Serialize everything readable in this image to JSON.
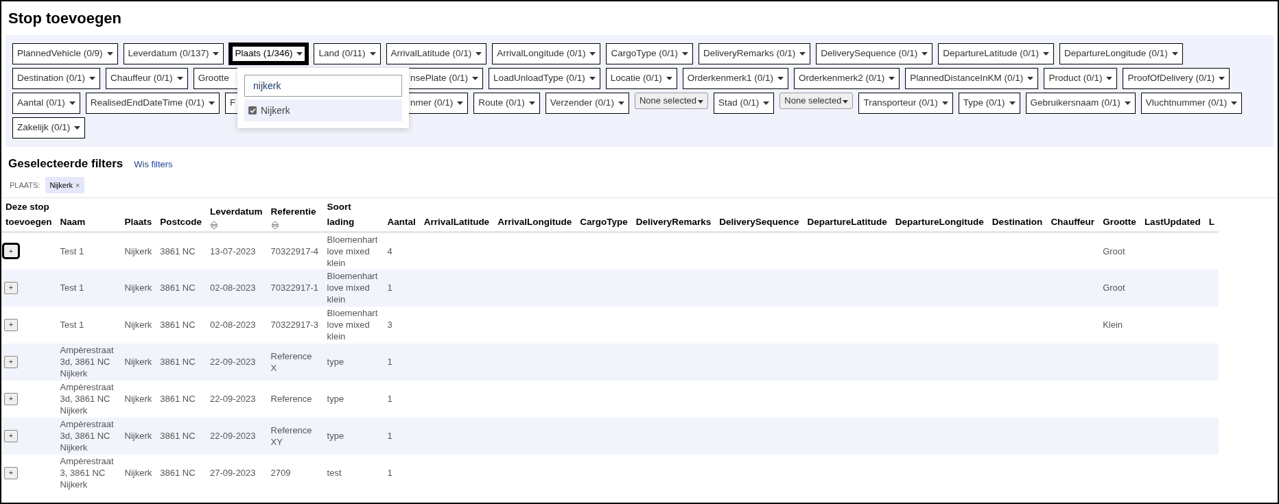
{
  "page": {
    "title": "Stop toevoegen"
  },
  "filter_rows": [
    [
      {
        "label": "PlannedVehicle (0/9)",
        "kind": "dropdown",
        "selected": false
      },
      {
        "label": "Leverdatum (0/137)",
        "kind": "dropdown",
        "selected": false
      },
      {
        "label": "Plaats (1/346)",
        "kind": "dropdown",
        "selected": true
      },
      {
        "label": "Land (0/11)",
        "kind": "dropdown",
        "selected": false
      },
      {
        "label": "ArrivalLatitude (0/1)",
        "kind": "dropdown",
        "selected": false
      },
      {
        "label": "ArrivalLongitude (0/1)",
        "kind": "dropdown",
        "selected": false
      },
      {
        "label": "CargoType (0/1)",
        "kind": "dropdown",
        "selected": false
      },
      {
        "label": "DeliveryRemarks (0/1)",
        "kind": "dropdown",
        "selected": false
      },
      {
        "label": "DeliverySequence (0/1)",
        "kind": "dropdown",
        "selected": false
      },
      {
        "label": "DepartureLatitude (0/1)",
        "kind": "dropdown",
        "selected": false
      },
      {
        "label": "DepartureLongitude (0/1)",
        "kind": "dropdown",
        "selected": false
      }
    ],
    [
      {
        "label": "Destination (0/1)",
        "kind": "dropdown",
        "selected": false
      },
      {
        "label": "Chauffeur (0/1)",
        "kind": "dropdown",
        "selected": false
      },
      {
        "label": "Grootte",
        "kind": "clipped-right"
      },
      {
        "label": "nsePlate (0/1)",
        "kind": "clipped-left"
      },
      {
        "label": "LoadUnloadType (0/1)",
        "kind": "dropdown",
        "selected": false
      },
      {
        "label": "Locatie (0/1)",
        "kind": "dropdown",
        "selected": false
      },
      {
        "label": "Orderkenmerk1 (0/1)",
        "kind": "dropdown",
        "selected": false
      },
      {
        "label": "Orderkenmerk2 (0/1)",
        "kind": "dropdown",
        "selected": false
      },
      {
        "label": "PlannedDistanceInKM (0/1)",
        "kind": "dropdown",
        "selected": false
      },
      {
        "label": "Product (0/1)",
        "kind": "dropdown",
        "selected": false
      },
      {
        "label": "ProofOfDelivery (0/1)",
        "kind": "dropdown",
        "selected": false
      }
    ],
    [
      {
        "label": "Aantal (0/1)",
        "kind": "dropdown",
        "selected": false
      },
      {
        "label": "RealisedEndDateTime (0/1)",
        "kind": "dropdown",
        "selected": false
      },
      {
        "label": "F",
        "kind": "clipped-right"
      },
      {
        "label": "nmer (0/1)",
        "kind": "clipped-left"
      },
      {
        "label": "Route (0/1)",
        "kind": "dropdown",
        "selected": false
      },
      {
        "label": "Verzender (0/1)",
        "kind": "dropdown",
        "selected": false
      },
      {
        "label": "None selected",
        "kind": "none-selected"
      },
      {
        "label": "Stad (0/1)",
        "kind": "dropdown",
        "selected": false
      },
      {
        "label": "None selected",
        "kind": "none-selected"
      },
      {
        "label": "Transporteur (0/1)",
        "kind": "dropdown",
        "selected": false
      },
      {
        "label": "Type (0/1)",
        "kind": "dropdown",
        "selected": false
      },
      {
        "label": "Gebruikersnaam (0/1)",
        "kind": "dropdown",
        "selected": false
      },
      {
        "label": "Vluchtnummer (0/1)",
        "kind": "dropdown",
        "selected": false
      }
    ],
    [
      {
        "label": "Zakelijk (0/1)",
        "kind": "dropdown",
        "selected": false
      }
    ]
  ],
  "filter_dropdown": {
    "search_value": "nijkerk",
    "options": [
      {
        "label": "Nijkerk",
        "checked": true
      }
    ]
  },
  "selected_filters": {
    "title": "Geselecteerde filters",
    "clear_link": "Wis filters",
    "chips": [
      {
        "label": "PLAATS:",
        "value": "Nijkerk",
        "remove": "×"
      }
    ]
  },
  "table": {
    "columns": [
      {
        "label": "Deze stop toevoegen",
        "sortable": false
      },
      {
        "label": "Naam",
        "sortable": false
      },
      {
        "label": "Plaats",
        "sortable": false
      },
      {
        "label": "Postcode",
        "sortable": false
      },
      {
        "label": "Leverdatum",
        "sortable": true
      },
      {
        "label": "Referentie",
        "sortable": true
      },
      {
        "label": "Soort lading",
        "sortable": false
      },
      {
        "label": "Aantal",
        "sortable": false
      },
      {
        "label": "ArrivalLatitude",
        "sortable": false
      },
      {
        "label": "ArrivalLongitude",
        "sortable": false
      },
      {
        "label": "CargoType",
        "sortable": false
      },
      {
        "label": "DeliveryRemarks",
        "sortable": false
      },
      {
        "label": "DeliverySequence",
        "sortable": false
      },
      {
        "label": "DepartureLatitude",
        "sortable": false
      },
      {
        "label": "DepartureLongitude",
        "sortable": false
      },
      {
        "label": "Destination",
        "sortable": false
      },
      {
        "label": "Chauffeur",
        "sortable": false
      },
      {
        "label": "Grootte",
        "sortable": false
      },
      {
        "label": "LastUpdated",
        "sortable": false
      },
      {
        "label": "L",
        "sortable": false
      }
    ],
    "rows": [
      {
        "focused": true,
        "cells": [
          "+",
          "Test 1",
          "Nijkerk",
          "3861 NC",
          "13-07-2023",
          "70322917-4",
          "Bloemenhart love mixed klein",
          "4",
          null,
          null,
          null,
          null,
          null,
          null,
          null,
          null,
          null,
          "Groot",
          null,
          null
        ]
      },
      {
        "focused": false,
        "cells": [
          "+",
          "Test 1",
          "Nijkerk",
          "3861 NC",
          "02-08-2023",
          "70322917-1",
          "Bloemenhart love mixed klein",
          "1",
          null,
          null,
          null,
          null,
          null,
          null,
          null,
          null,
          null,
          "Groot",
          null,
          null
        ]
      },
      {
        "focused": false,
        "cells": [
          "+",
          "Test 1",
          "Nijkerk",
          "3861 NC",
          "02-08-2023",
          "70322917-3",
          "Bloemenhart love mixed klein",
          "3",
          null,
          null,
          null,
          null,
          null,
          null,
          null,
          null,
          null,
          "Klein",
          null,
          null
        ]
      },
      {
        "focused": false,
        "cells": [
          "+",
          "Ampèrestraat 3d, 3861 NC Nijkerk",
          "Nijkerk",
          "3861 NC",
          "22-09-2023",
          "Reference X",
          "type",
          "1",
          null,
          null,
          null,
          null,
          null,
          null,
          null,
          null,
          null,
          null,
          null,
          null
        ]
      },
      {
        "focused": false,
        "cells": [
          "+",
          "Ampèrestraat 3d, 3861 NC Nijkerk",
          "Nijkerk",
          "3861 NC",
          "22-09-2023",
          "Reference",
          "type",
          "1",
          null,
          null,
          null,
          null,
          null,
          null,
          null,
          null,
          null,
          null,
          null,
          null
        ]
      },
      {
        "focused": false,
        "cells": [
          "+",
          "Ampèrestraat 3d, 3861 NC Nijkerk",
          "Nijkerk",
          "3861 NC",
          "22-09-2023",
          "Reference XY",
          "type",
          "1",
          null,
          null,
          null,
          null,
          null,
          null,
          null,
          null,
          null,
          null,
          null,
          null
        ]
      },
      {
        "focused": false,
        "cells": [
          "+",
          "Ampèrestraat 3, 3861 NC Nijkerk",
          "Nijkerk",
          "3861 NC",
          "27-09-2023",
          "2709",
          "test",
          "1",
          null,
          null,
          null,
          null,
          null,
          null,
          null,
          null,
          null,
          null,
          null,
          null
        ]
      }
    ]
  }
}
